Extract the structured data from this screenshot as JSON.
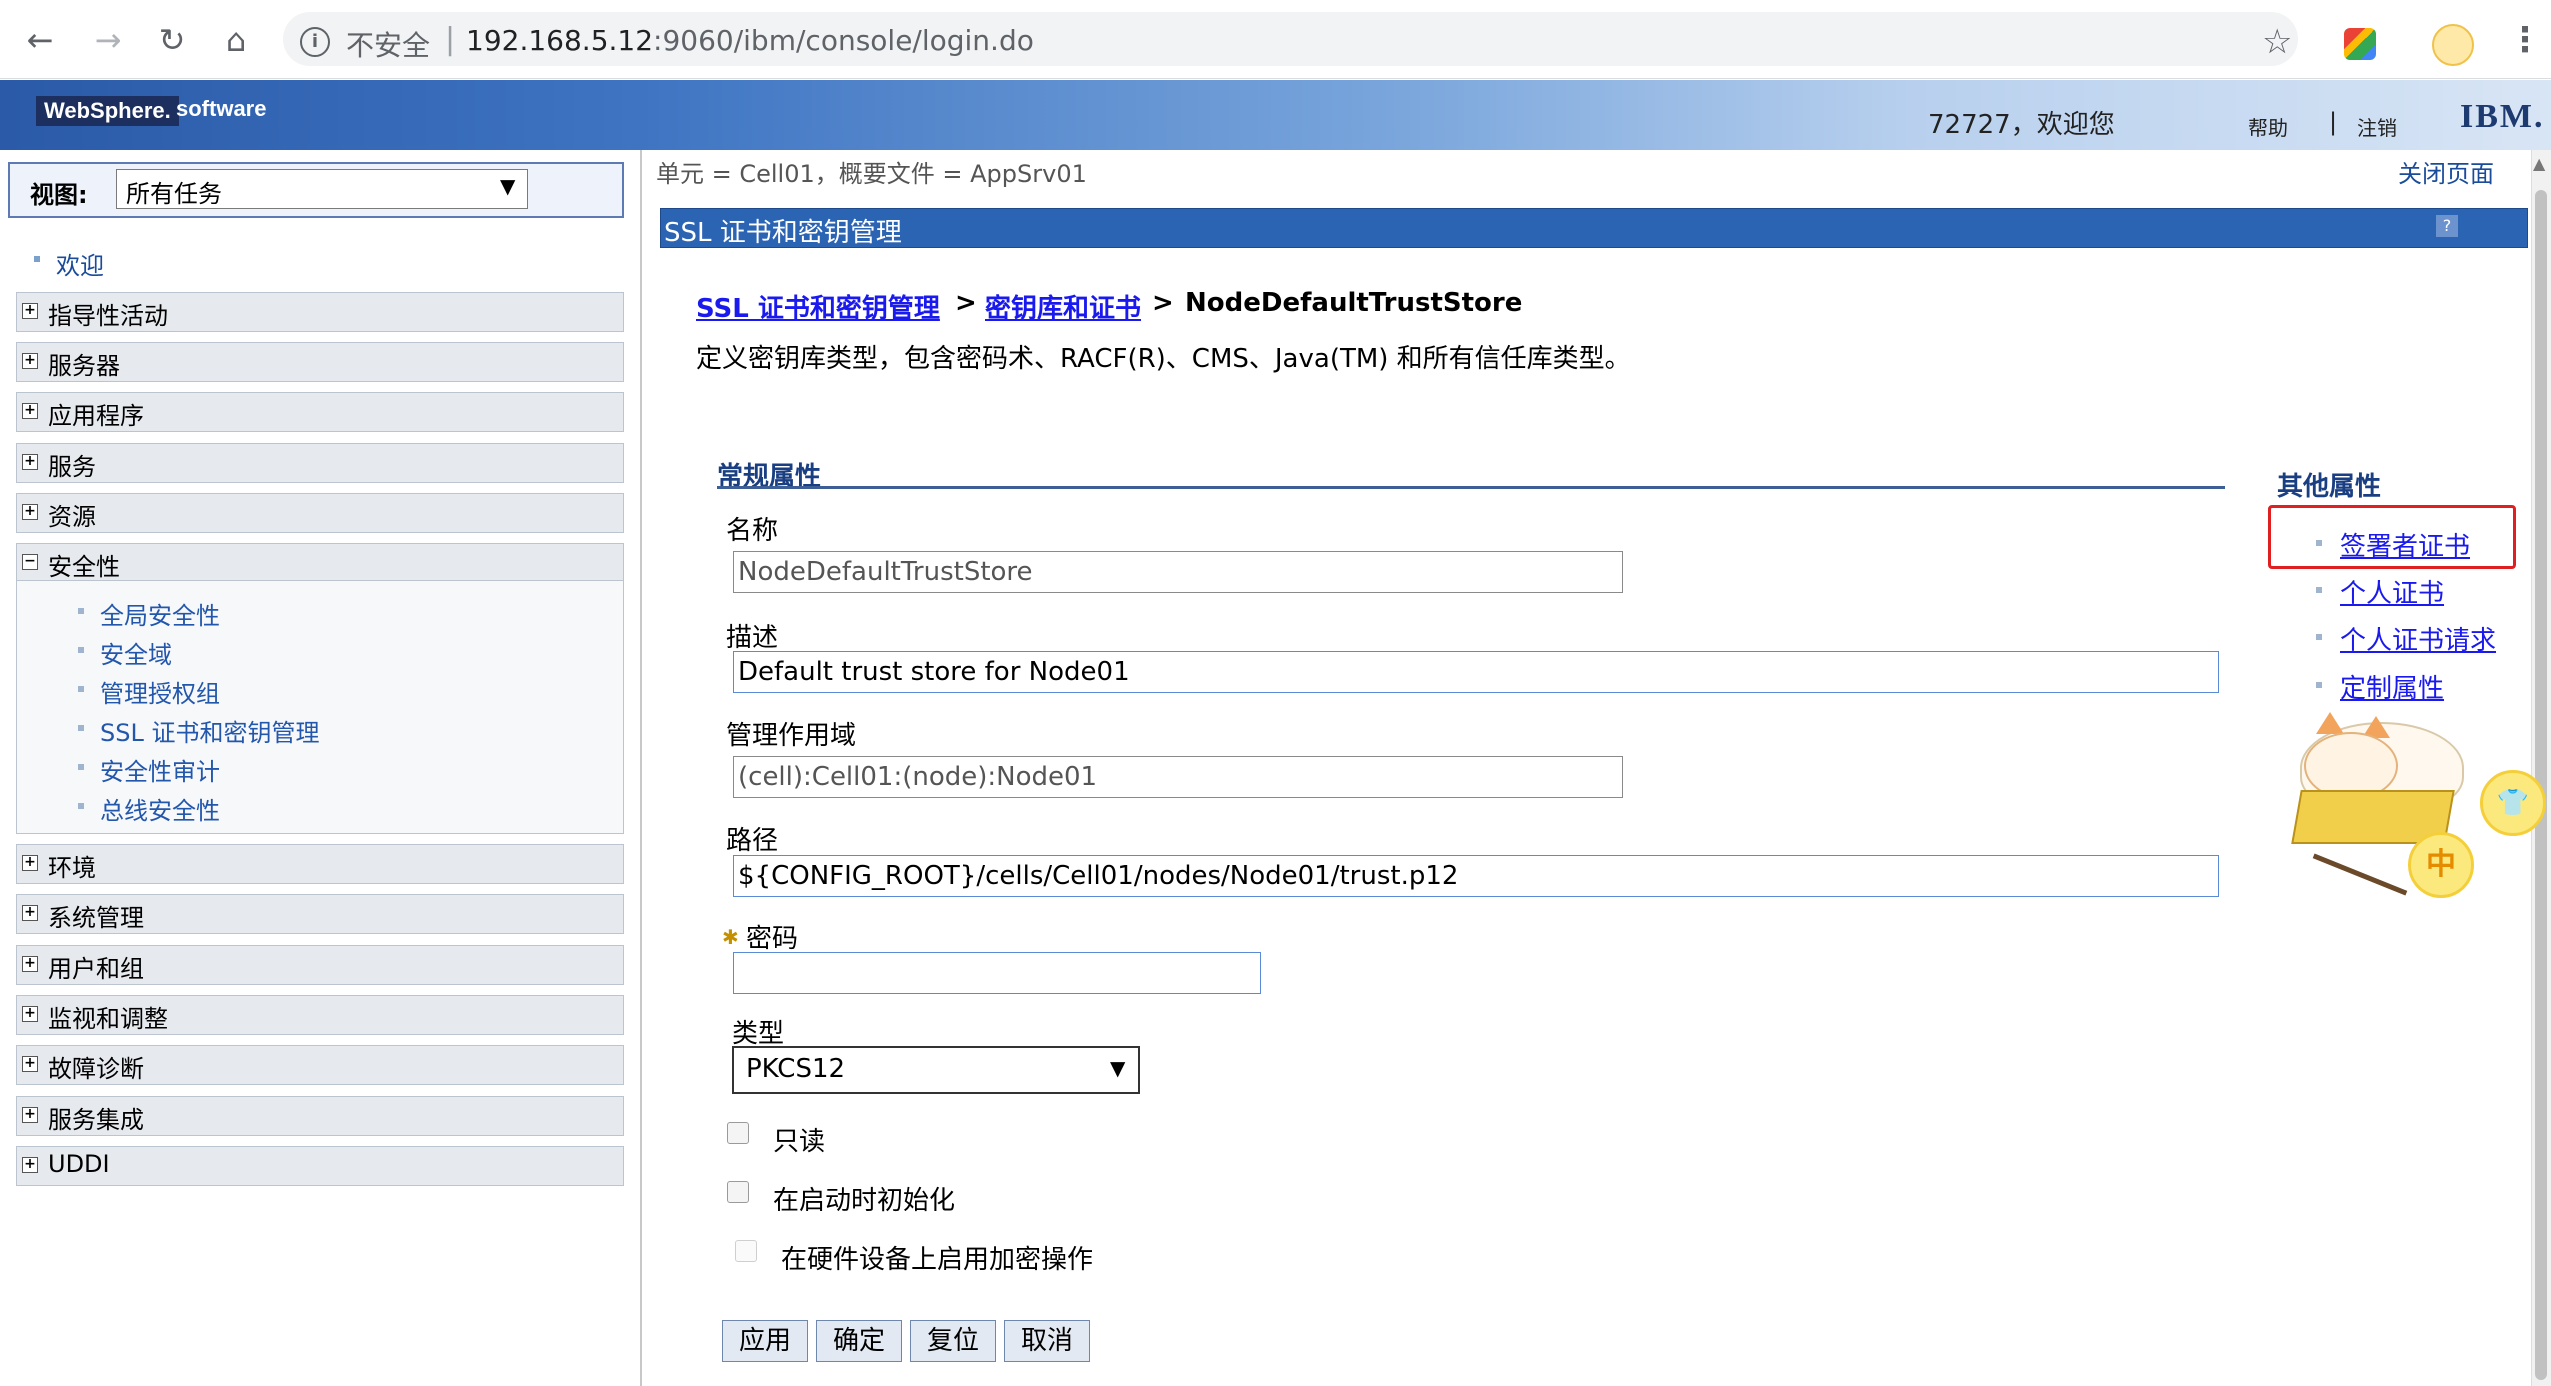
{
  "browser": {
    "security_label": "不安全",
    "url_host": "192.168.5.12",
    "url_rest": ":9060/ibm/console/login.do",
    "back": "←",
    "forward": "→",
    "reload": "↻",
    "home": "⌂",
    "star": "☆",
    "menu": "⋮"
  },
  "banner": {
    "logo": "WebSphere.",
    "logo_suffix": "software",
    "welcome": "72727，欢迎您",
    "help": "帮助",
    "separator": "|",
    "logout": "注销",
    "ibm": "IBM."
  },
  "nav": {
    "view_label": "视图:",
    "view_value": "所有任务",
    "view_arrow": "▼",
    "welcome": "欢迎",
    "groups_top": [
      {
        "label": "指导性活动",
        "sign": "+"
      },
      {
        "label": "服务器",
        "sign": "+"
      },
      {
        "label": "应用程序",
        "sign": "+"
      },
      {
        "label": "服务",
        "sign": "+"
      },
      {
        "label": "资源",
        "sign": "+"
      }
    ],
    "security": {
      "label": "安全性",
      "sign": "−",
      "items": [
        "全局安全性",
        "安全域",
        "管理授权组",
        "SSL 证书和密钥管理",
        "安全性审计",
        "总线安全性"
      ]
    },
    "groups_bottom": [
      {
        "label": "环境",
        "sign": "+"
      },
      {
        "label": "系统管理",
        "sign": "+"
      },
      {
        "label": "用户和组",
        "sign": "+"
      },
      {
        "label": "监视和调整",
        "sign": "+"
      },
      {
        "label": "故障诊断",
        "sign": "+"
      },
      {
        "label": "服务集成",
        "sign": "+"
      },
      {
        "label": "UDDI",
        "sign": "+"
      }
    ]
  },
  "content": {
    "scope_text": "单元 = Cell01，概要文件 = AppSrv01",
    "close_page": "关闭页面",
    "panel_title": "SSL 证书和密钥管理",
    "panel_help": "?",
    "breadcrumb": {
      "link1": "SSL 证书和密钥管理",
      "sep": ">",
      "link2": "密钥库和证书",
      "current": "NodeDefaultTrustStore"
    },
    "description": "定义密钥库类型，包含密码术、RACF(R)、CMS、Java(TM) 和所有信任库类型。",
    "general_heading": "常规属性",
    "fields": {
      "name_label": "名称",
      "name_value": "NodeDefaultTrustStore",
      "desc_label": "描述",
      "desc_value": "Default trust store for Node01",
      "scope_label": "管理作用域",
      "scope_value": "(cell):Cell01:(node):Node01",
      "path_label": "路径",
      "path_value": "${CONFIG_ROOT}/cells/Cell01/nodes/Node01/trust.p12",
      "password_label": "密码",
      "password_required": "✱",
      "password_value": "",
      "type_label": "类型",
      "type_value": "PKCS12",
      "type_arrow": "▼"
    },
    "checkboxes": {
      "readonly": "只读",
      "init_on_startup": "在启动时初始化",
      "hw_crypto": "在硬件设备上启用加密操作"
    },
    "buttons": {
      "apply": "应用",
      "ok": "确定",
      "reset": "复位",
      "cancel": "取消"
    },
    "other_heading": "其他属性",
    "other_links": [
      "签署者证书",
      "个人证书",
      "个人证书请求",
      "定制属性"
    ],
    "decor": {
      "circle1": "👕",
      "circle2": "中"
    }
  }
}
